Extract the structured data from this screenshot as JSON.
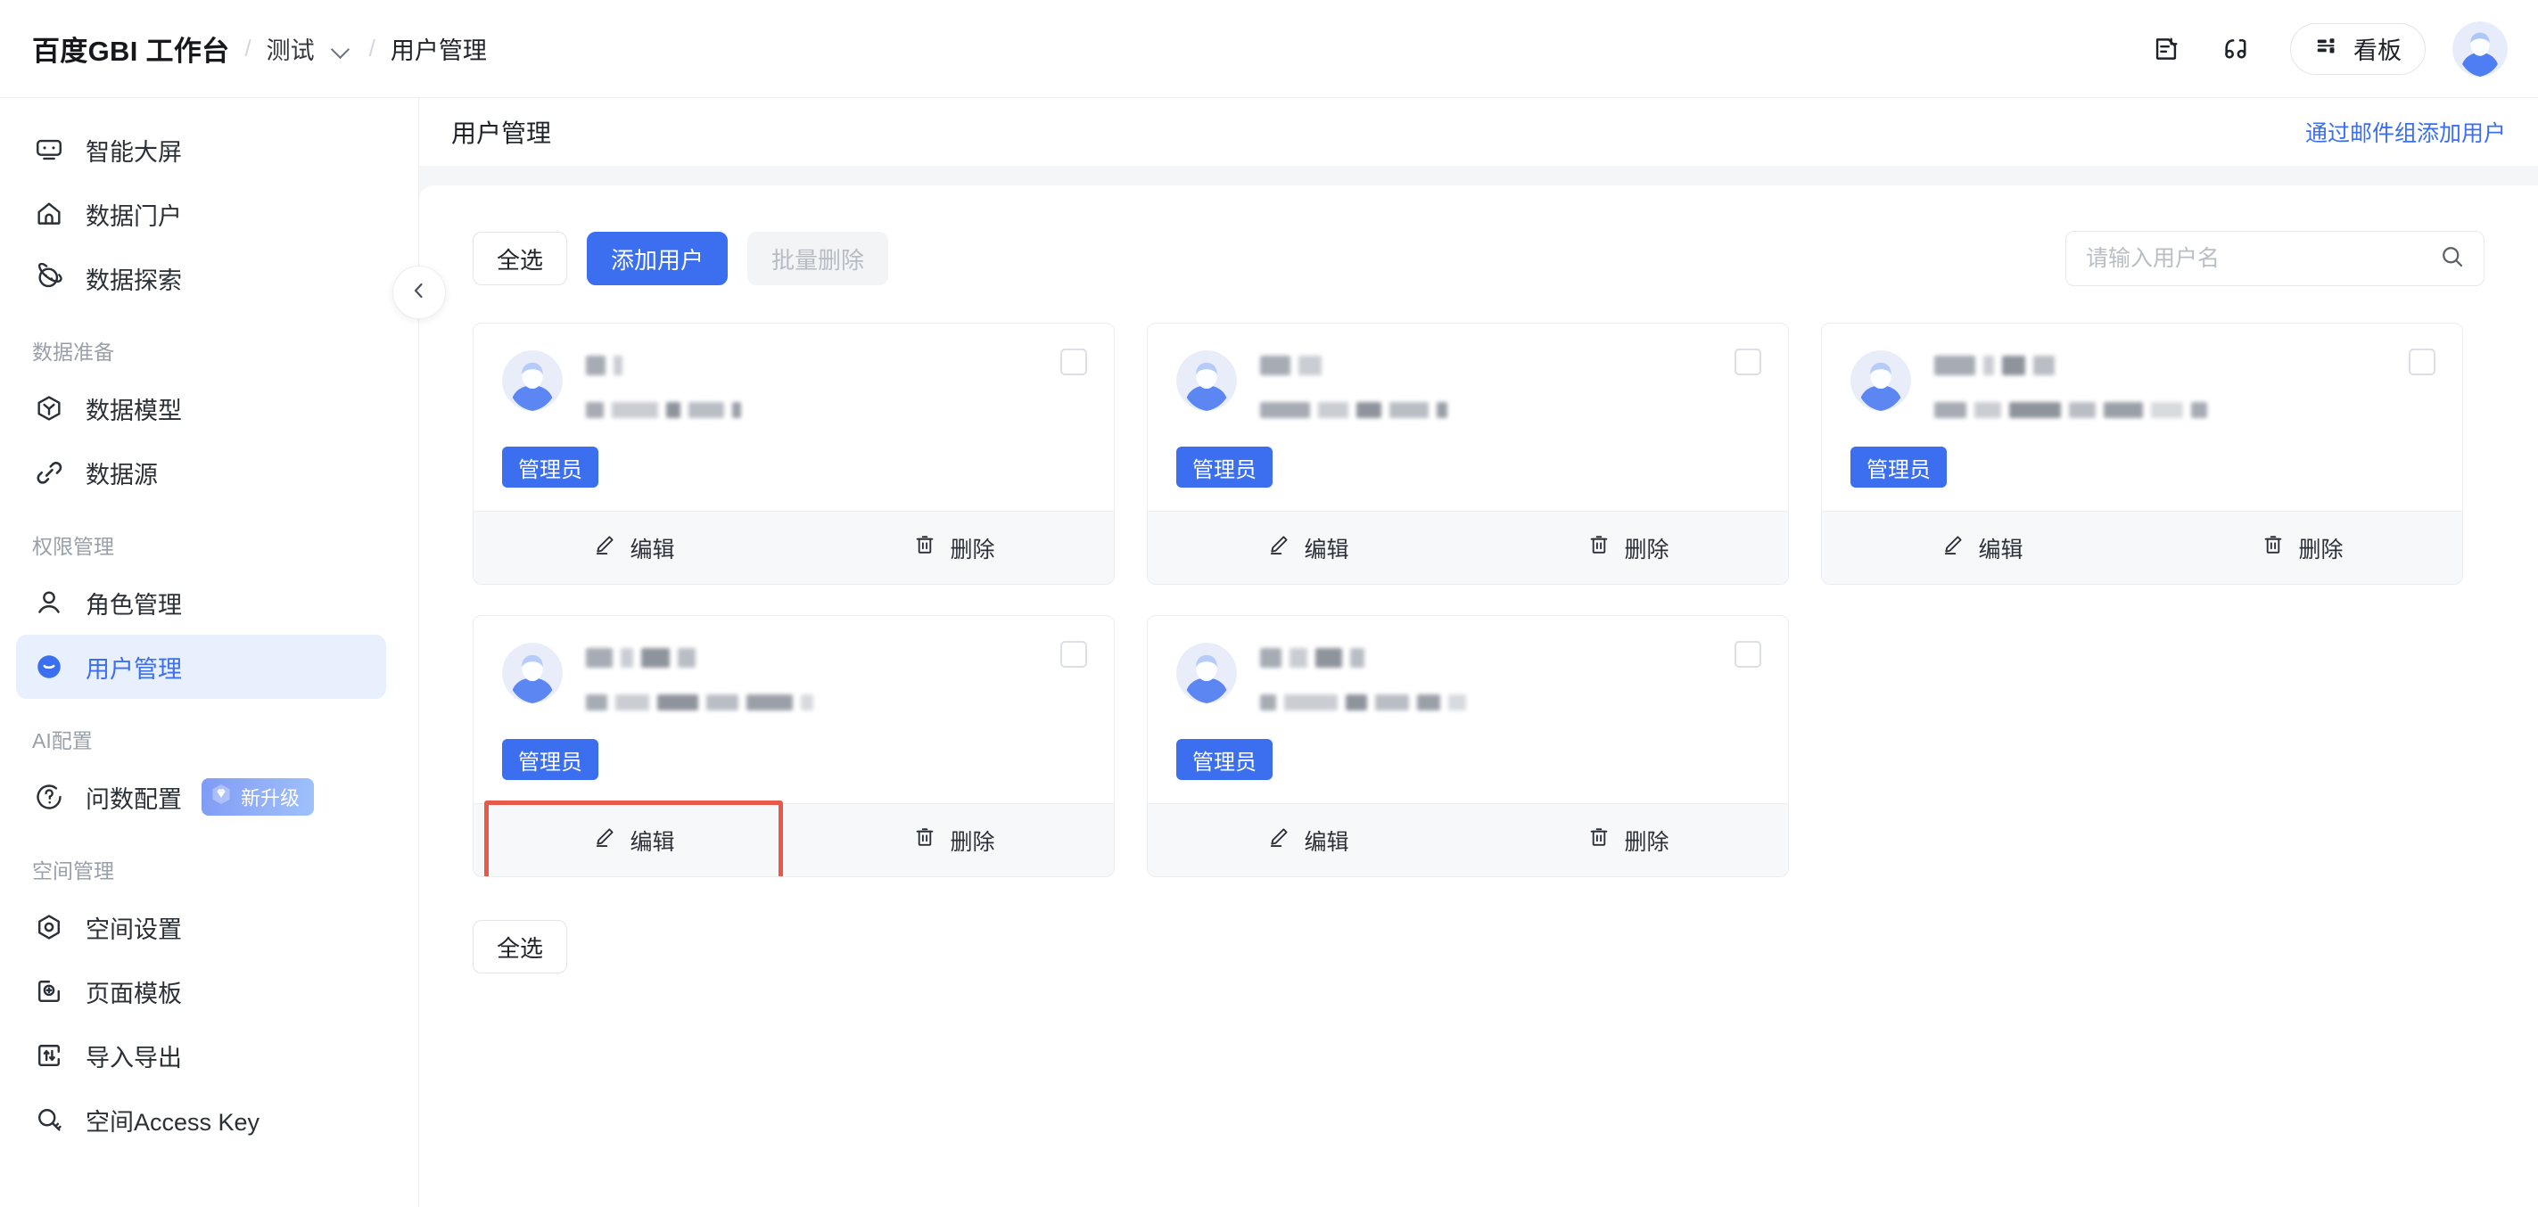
{
  "topbar": {
    "brand": "百度GBI 工作台",
    "sep": "/",
    "workspace": "测试",
    "current": "用户管理",
    "icons": [
      {
        "name": "document-edit-icon"
      },
      {
        "name": "headset-icon"
      }
    ],
    "kanban_label": "看板",
    "avatar_name": "user-avatar"
  },
  "sidebar": {
    "collapse_icon": "chevron-left-icon",
    "sections": [
      {
        "group": null,
        "items": [
          {
            "label": "智能大屏",
            "icon": "robot-screen-icon",
            "active": false
          },
          {
            "label": "数据门户",
            "icon": "home-icon",
            "active": false
          },
          {
            "label": "数据探索",
            "icon": "explore-planet-icon",
            "active": false
          }
        ]
      },
      {
        "group": "数据准备",
        "items": [
          {
            "label": "数据模型",
            "icon": "cube-model-icon",
            "active": false
          },
          {
            "label": "数据源",
            "icon": "link-icon",
            "active": false
          }
        ]
      },
      {
        "group": "权限管理",
        "items": [
          {
            "label": "角色管理",
            "icon": "user-role-icon",
            "active": false
          },
          {
            "label": "用户管理",
            "icon": "user-circle-icon",
            "active": true
          }
        ]
      },
      {
        "group": "AI配置",
        "items": [
          {
            "label": "问数配置",
            "icon": "question-circle-icon",
            "active": false,
            "badge": "新升级",
            "badge_icon": "diamond-icon"
          }
        ]
      },
      {
        "group": "空间管理",
        "items": [
          {
            "label": "空间设置",
            "icon": "settings-hex-icon",
            "active": false
          },
          {
            "label": "页面模板",
            "icon": "plus-square-icon",
            "active": false
          },
          {
            "label": "导入导出",
            "icon": "import-export-icon",
            "active": false
          },
          {
            "label": "空间Access Key",
            "icon": "key-search-icon",
            "active": false
          }
        ]
      }
    ]
  },
  "page": {
    "title": "用户管理",
    "header_link": "通过邮件组添加用户"
  },
  "toolbar": {
    "select_all": "全选",
    "add_user": "添加用户",
    "batch_delete": "批量删除",
    "batch_delete_disabled": true,
    "search_placeholder": "请输入用户名",
    "search_value": "",
    "search_icon": "search-icon"
  },
  "card_actions": {
    "edit": "编辑",
    "delete": "删除",
    "edit_icon": "pencil-icon",
    "delete_icon": "trash-icon",
    "checkbox_name": "select-user-checkbox"
  },
  "role_tag": "管理员",
  "bottom": {
    "select_all": "全选"
  },
  "highlight": {
    "color": "#e8594a",
    "target_card_index": 3,
    "target_action": "编辑"
  },
  "users": [
    {
      "role": "管理员",
      "checked": false,
      "name_redacted": [
        22,
        10
      ],
      "mail_redacted": [
        20,
        52,
        16,
        40,
        10
      ],
      "highlight_edit": false
    },
    {
      "role": "管理员",
      "checked": false,
      "name_redacted": [
        34,
        26
      ],
      "mail_redacted": [
        56,
        34,
        28,
        44,
        12
      ],
      "highlight_edit": false
    },
    {
      "role": "管理员",
      "checked": false,
      "name_redacted": [
        46,
        12,
        26,
        24
      ],
      "mail_redacted": [
        36,
        30,
        58,
        30,
        44,
        36,
        18
      ],
      "highlight_edit": false
    },
    {
      "role": "管理员",
      "checked": false,
      "name_redacted": [
        30,
        14,
        32,
        20
      ],
      "mail_redacted": [
        24,
        38,
        46,
        36,
        52,
        14
      ],
      "highlight_edit": true
    },
    {
      "role": "管理员",
      "checked": false,
      "name_redacted": [
        24,
        20,
        30,
        16
      ],
      "mail_redacted": [
        18,
        60,
        24,
        38,
        26,
        20
      ],
      "highlight_edit": false
    }
  ]
}
